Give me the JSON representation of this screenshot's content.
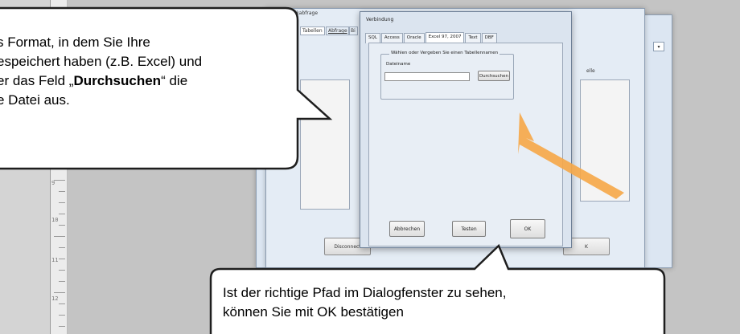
{
  "ruler": {
    "numbers": [
      "9",
      "10",
      "11",
      "12"
    ]
  },
  "back_window": {
    "title": "Datenbankabfrage",
    "tabs": [
      "Tabellen",
      "Abfrage",
      "Bi"
    ],
    "disconnect_label": "Disconnect",
    "right_label": "elle",
    "right_button": "K",
    "combo_icon": "chevron-down-icon"
  },
  "dialog": {
    "title": "Verbindung",
    "tabs": [
      "SQL",
      "Access",
      "Oracle",
      "Excel 97, 2007",
      "Text",
      "DBF"
    ],
    "active_tab_index": 3,
    "group_legend": "Wählen oder Vergeben Sie einen Tabellennamen",
    "filename_label": "Dateiname",
    "filename_value": "",
    "browse_button": "Durchsuchen",
    "cancel_button": "Abbrechen",
    "test_button": "Testen",
    "ok_button": "OK"
  },
  "callouts": {
    "top_lines": [
      "s Format, in dem Sie Ihre",
      "espeichert haben (z.B. Excel) und",
      "er das Feld „",
      "Durchsuchen",
      "“ die",
      "e Datei aus."
    ],
    "bottom_lines": [
      "Ist der richtige Pfad im Dialogfenster zu sehen,",
      "können Sie mit OK bestätigen"
    ]
  },
  "colors": {
    "arrow": "#f5a84a",
    "workspace": "#c4c4c4",
    "dialog_bg": "#dbe4ef"
  }
}
